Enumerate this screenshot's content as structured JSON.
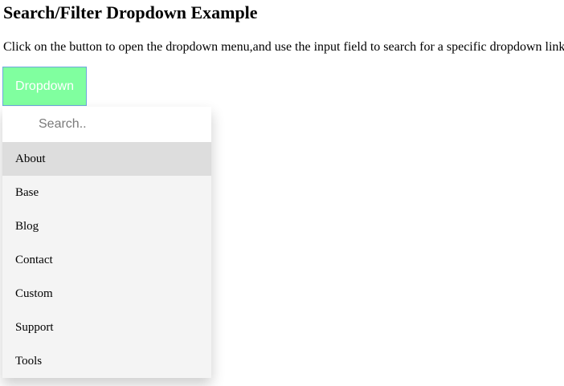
{
  "page": {
    "title": "Search/Filter Dropdown Example",
    "description": "Click on the button to open the dropdown menu,and use the input field to search for a specific dropdown link"
  },
  "dropdown": {
    "button_label": "Dropdown",
    "search_placeholder": "Search..",
    "search_value": "",
    "items": [
      {
        "label": "About",
        "highlighted": true
      },
      {
        "label": "Base",
        "highlighted": false
      },
      {
        "label": "Blog",
        "highlighted": false
      },
      {
        "label": "Contact",
        "highlighted": false
      },
      {
        "label": "Custom",
        "highlighted": false
      },
      {
        "label": "Support",
        "highlighted": false
      },
      {
        "label": "Tools",
        "highlighted": false
      }
    ]
  },
  "colors": {
    "button_background": "#80ff9f",
    "button_border": "#6fa6dd",
    "button_text": "#ffffff",
    "menu_background": "#f4f4f4",
    "item_highlight": "#dddddd"
  }
}
